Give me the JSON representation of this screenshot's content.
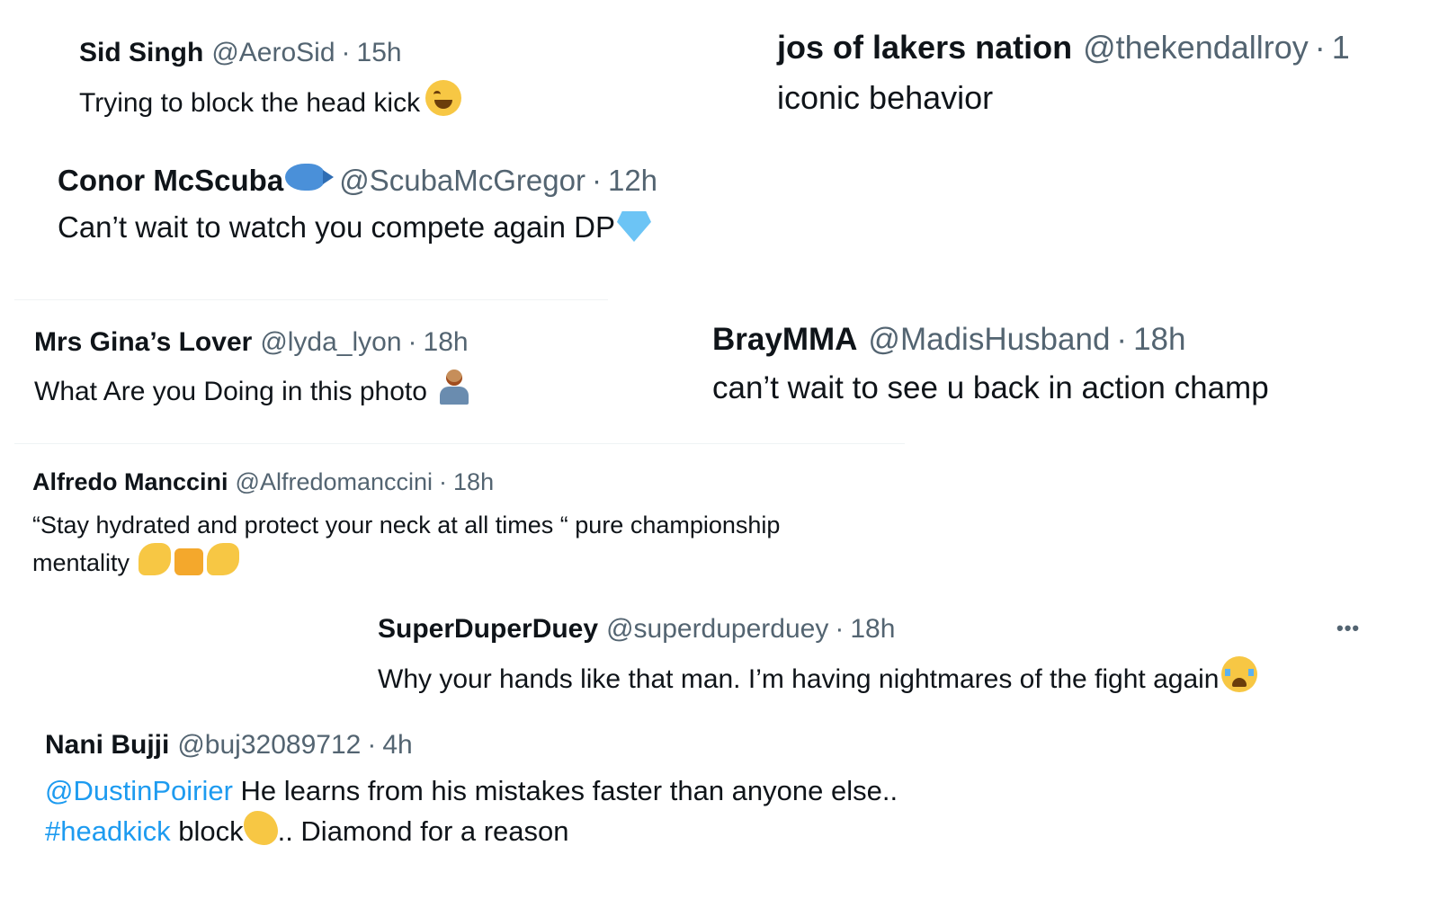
{
  "tweets": [
    {
      "name": "Sid Singh",
      "handle": "@AeroSid",
      "time": "15h",
      "text": "Trying to block the head kick",
      "emoji": "face-with-tears-of-joy"
    },
    {
      "name": "jos of lakers nation",
      "handle": "@thekendallroy",
      "time": "1",
      "text": "iconic behavior"
    },
    {
      "name": "Conor McScuba",
      "name_emoji": "fish",
      "handle": "@ScubaMcGregor",
      "time": "12h",
      "text": "Can’t wait to watch you compete again DP",
      "emoji": "gem-stone"
    },
    {
      "name": "Mrs Gina’s Lover",
      "handle": "@lyda_lyon",
      "time": "18h",
      "text": "What Are you Doing in this photo",
      "emoji": "person-shrugging"
    },
    {
      "name": "BrayMMA",
      "handle": "@MadisHusband",
      "time": "18h",
      "text": "can’t wait to see u back in action champ"
    },
    {
      "name": "Alfredo Manccini",
      "handle": "@Alfredomanccini",
      "time": "18h",
      "text_line1": "“Stay hydrated and protect your neck at all times “ pure championship",
      "text_line2": "mentality",
      "emojis": [
        "flexed-biceps",
        "oncoming-fist",
        "flexed-biceps"
      ]
    },
    {
      "name": "SuperDuperDuey",
      "handle": "@superduperduey",
      "time": "18h",
      "more": "•••",
      "text": "Why your hands like that man. I’m having nightmares of the fight again",
      "emoji": "loudly-crying-face"
    },
    {
      "name": "Nani Bujji",
      "handle": "@buj32089712",
      "time": "4h",
      "mention": "@DustinPoirier",
      "text_line1": " He learns from his mistakes faster than anyone else..",
      "hashtag": "#headkick",
      "text_line2a": " block",
      "text_line2b": ".. Diamond for a reason",
      "emoji": "clapping-hands"
    }
  ],
  "separator": "·",
  "colors": {
    "name": "#0f1419",
    "handle": "#536471",
    "link": "#1d9bf0",
    "divider": "#eff3f4"
  }
}
